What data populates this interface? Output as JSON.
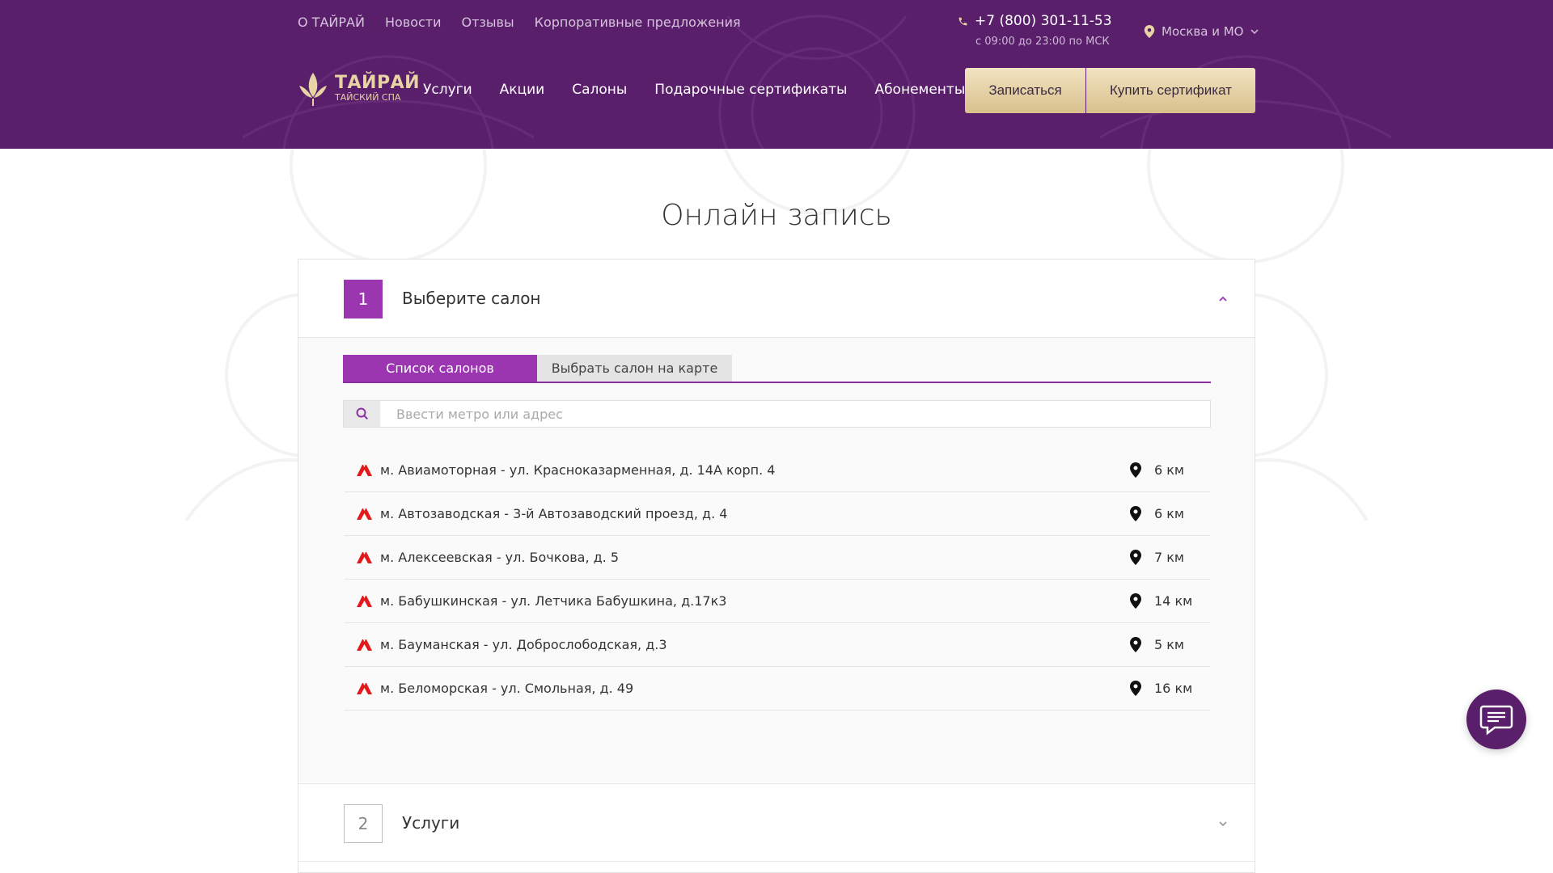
{
  "header": {
    "top_links": [
      "О ТАЙРАЙ",
      "Новости",
      "Отзывы",
      "Корпоративные предложения"
    ],
    "phone": "+7 (800) 301-11-53",
    "phone_hours": "с 09:00 до 23:00 по МСК",
    "region": "Москва и МО",
    "logo_name": "ТАЙРАЙ",
    "logo_tagline": "ТАЙСКИЙ СПА",
    "nav": [
      "Услуги",
      "Акции",
      "Салоны",
      "Подарочные сертификаты",
      "Абонементы"
    ],
    "book_label": "Записаться",
    "cert_label": "Купить сертификат"
  },
  "page": {
    "title": "Онлайн запись"
  },
  "step1": {
    "number": "1",
    "title": "Выберите салон",
    "tabs": [
      "Список салонов",
      "Выбрать салон на карте"
    ],
    "search_placeholder": "Ввести метро или адрес",
    "salons": [
      {
        "address": "м. Авиамоторная - ул. Красноказарменная, д. 14А корп. 4",
        "distance": "6 км"
      },
      {
        "address": "м. Автозаводская - 3-й Автозаводский проезд, д. 4",
        "distance": "6 км"
      },
      {
        "address": "м. Алексеевская - ул. Бочкова, д. 5",
        "distance": "7 км"
      },
      {
        "address": "м. Бабушкинская - ул. Летчика Бабушкина, д.17к3",
        "distance": "14 км"
      },
      {
        "address": "м. Бауманская - ул. Доброслободская, д.3",
        "distance": "5 км"
      },
      {
        "address": "м. Беломорская - ул. Смольная, д. 49",
        "distance": "16 км"
      }
    ]
  },
  "step2": {
    "number": "2",
    "title": "Услуги"
  },
  "icons": {
    "phone": "phone-icon",
    "region": "location-pin-icon",
    "chevron_down": "chevron-down-icon",
    "chevron_up": "chevron-up-icon",
    "search": "search-icon",
    "metro": "metro-icon",
    "pin": "map-pin-icon",
    "chat": "chat-icon",
    "logo": "lotus-leaf-icon"
  },
  "colors": {
    "header_bg": "#5a1f6b",
    "accent": "#9b35b0",
    "gold": "#e7d3a4",
    "metro_red": "#e4191c"
  }
}
